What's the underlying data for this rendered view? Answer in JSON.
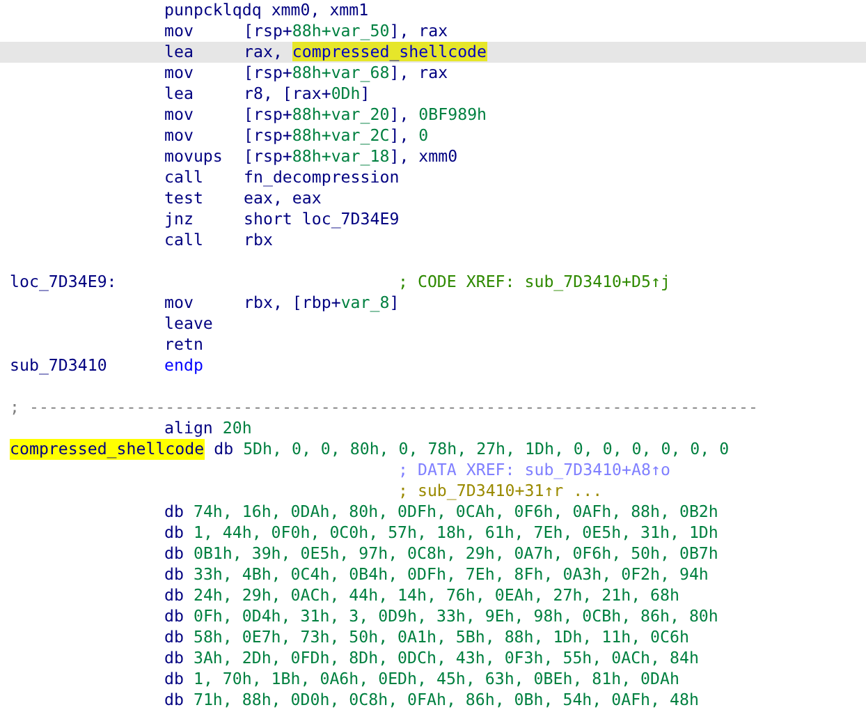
{
  "lines": [
    {
      "kind": "instruction",
      "selected": false,
      "mnemonic": "punpcklqdq",
      "operands": [
        {
          "text": "xmm0, xmm1",
          "kind": "plain"
        }
      ]
    },
    {
      "kind": "instruction",
      "selected": false,
      "mnemonic": "mov",
      "operands": [
        {
          "text": "[rsp+",
          "kind": "plain"
        },
        {
          "text": "88h+var_50",
          "kind": "var"
        },
        {
          "text": "], rax",
          "kind": "plain"
        }
      ]
    },
    {
      "kind": "instruction",
      "selected": true,
      "mnemonic": "lea",
      "operands": [
        {
          "text": "rax, ",
          "kind": "plain"
        },
        {
          "text": "compressed_shellcode",
          "kind": "highlight"
        }
      ]
    },
    {
      "kind": "instruction",
      "selected": false,
      "mnemonic": "mov",
      "operands": [
        {
          "text": "[rsp+",
          "kind": "plain"
        },
        {
          "text": "88h+var_68",
          "kind": "var"
        },
        {
          "text": "], rax",
          "kind": "plain"
        }
      ]
    },
    {
      "kind": "instruction",
      "selected": false,
      "mnemonic": "lea",
      "operands": [
        {
          "text": "r8, [rax+",
          "kind": "plain"
        },
        {
          "text": "0Dh",
          "kind": "num"
        },
        {
          "text": "]",
          "kind": "plain"
        }
      ]
    },
    {
      "kind": "instruction",
      "selected": false,
      "mnemonic": "mov",
      "operands": [
        {
          "text": "[rsp+",
          "kind": "plain"
        },
        {
          "text": "88h+var_20",
          "kind": "var"
        },
        {
          "text": "], ",
          "kind": "plain"
        },
        {
          "text": "0BF989h",
          "kind": "num"
        }
      ]
    },
    {
      "kind": "instruction",
      "selected": false,
      "mnemonic": "mov",
      "operands": [
        {
          "text": "[rsp+",
          "kind": "plain"
        },
        {
          "text": "88h+var_2C",
          "kind": "var"
        },
        {
          "text": "], ",
          "kind": "plain"
        },
        {
          "text": "0",
          "kind": "num"
        }
      ]
    },
    {
      "kind": "instruction",
      "selected": false,
      "mnemonic": "movups",
      "operands": [
        {
          "text": "[rsp+",
          "kind": "plain"
        },
        {
          "text": "88h+var_18",
          "kind": "var"
        },
        {
          "text": "], xmm0",
          "kind": "plain"
        }
      ]
    },
    {
      "kind": "instruction",
      "selected": false,
      "mnemonic": "call",
      "operands": [
        {
          "text": "fn_decompression",
          "kind": "name"
        }
      ]
    },
    {
      "kind": "instruction",
      "selected": false,
      "mnemonic": "test",
      "operands": [
        {
          "text": "eax, eax",
          "kind": "plain"
        }
      ]
    },
    {
      "kind": "instruction",
      "selected": false,
      "mnemonic": "jnz",
      "operands": [
        {
          "text": "short loc_7D34E9",
          "kind": "plain"
        }
      ]
    },
    {
      "kind": "instruction",
      "selected": false,
      "mnemonic": "call",
      "operands": [
        {
          "text": "rbx",
          "kind": "plain"
        }
      ]
    },
    {
      "kind": "blank",
      "selected": false
    },
    {
      "kind": "label",
      "selected": false,
      "label": "loc_7D34E9:",
      "comment": "; CODE XREF: sub_7D3410+D5↑j",
      "color": "#2f8a00"
    },
    {
      "kind": "instruction",
      "selected": false,
      "mnemonic": "mov",
      "operands": [
        {
          "text": "rbx, [rbp+",
          "kind": "plain"
        },
        {
          "text": "var_8",
          "kind": "var"
        },
        {
          "text": "]",
          "kind": "plain"
        }
      ]
    },
    {
      "kind": "instruction",
      "selected": false,
      "mnemonic": "leave"
    },
    {
      "kind": "instruction",
      "selected": false,
      "mnemonic": "retn"
    },
    {
      "kind": "proc_end",
      "selected": false,
      "label": "sub_7D3410",
      "keyword": "endp"
    },
    {
      "kind": "blank",
      "selected": false
    },
    {
      "kind": "separator",
      "selected": false,
      "text": "; ---------------------------------------------------------------------------"
    },
    {
      "kind": "directive",
      "selected": false,
      "directive": "align",
      "value": "20h"
    },
    {
      "kind": "data_label",
      "selected": false,
      "label": "compressed_shellcode",
      "highlighted": true,
      "directive": "db",
      "values": "5Dh, 0, 0, 80h, 0, 78h, 27h, 1Dh, 0, 0, 0, 0, 0, 0"
    },
    {
      "kind": "comment",
      "selected": false,
      "comment": "; DATA XREF: sub_7D3410+A8↑o",
      "color": "#8080ff"
    },
    {
      "kind": "comment",
      "selected": false,
      "comment": "; sub_7D3410+31↑r ...",
      "color": "#9a8a00"
    },
    {
      "kind": "data",
      "selected": false,
      "directive": "db",
      "values": "74h, 16h, 0DAh, 80h, 0DFh, 0CAh, 0F6h, 0AFh, 88h, 0B2h"
    },
    {
      "kind": "data",
      "selected": false,
      "directive": "db",
      "values": "1, 44h, 0F0h, 0C0h, 57h, 18h, 61h, 7Eh, 0E5h, 31h, 1Dh"
    },
    {
      "kind": "data",
      "selected": false,
      "directive": "db",
      "values": "0B1h, 39h, 0E5h, 97h, 0C8h, 29h, 0A7h, 0F6h, 50h, 0B7h"
    },
    {
      "kind": "data",
      "selected": false,
      "directive": "db",
      "values": "33h, 4Bh, 0C4h, 0B4h, 0DFh, 7Eh, 8Fh, 0A3h, 0F2h, 94h"
    },
    {
      "kind": "data",
      "selected": false,
      "directive": "db",
      "values": "24h, 29h, 0ACh, 44h, 14h, 76h, 0EAh, 27h, 21h, 68h"
    },
    {
      "kind": "data",
      "selected": false,
      "directive": "db",
      "values": "0Fh, 0D4h, 31h, 3, 0D9h, 33h, 9Eh, 98h, 0CBh, 86h, 80h"
    },
    {
      "kind": "data",
      "selected": false,
      "directive": "db",
      "values": "58h, 0E7h, 73h, 50h, 0A1h, 5Bh, 88h, 1Dh, 11h, 0C6h"
    },
    {
      "kind": "data",
      "selected": false,
      "directive": "db",
      "values": "3Ah, 2Dh, 0FDh, 8Dh, 0DCh, 43h, 0F3h, 55h, 0ACh, 84h"
    },
    {
      "kind": "data",
      "selected": false,
      "directive": "db",
      "values": "1, 70h, 1Bh, 0A6h, 0EDh, 45h, 63h, 0BEh, 81h, 0DAh"
    },
    {
      "kind": "data",
      "selected": false,
      "directive": "db",
      "values": "71h, 88h, 0D0h, 0C8h, 0FAh, 86h, 0Bh, 54h, 0AFh, 48h"
    }
  ]
}
